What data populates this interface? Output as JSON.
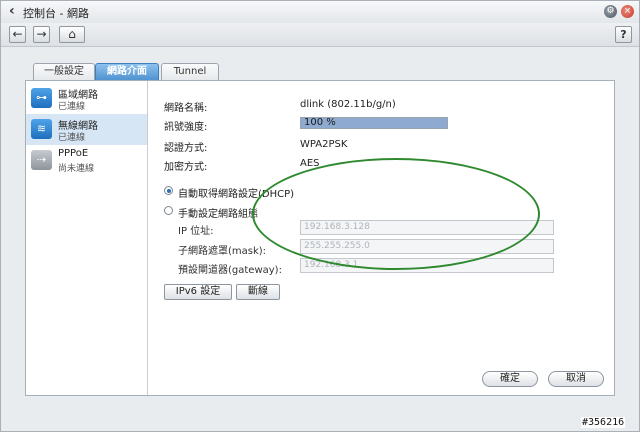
{
  "window": {
    "title": "控制台 - 網路"
  },
  "tabs": [
    {
      "label": "一般設定"
    },
    {
      "label": "網路介面"
    },
    {
      "label": "Tunnel"
    }
  ],
  "sidebar": {
    "items": [
      {
        "name": "區域網路",
        "status": "已連線"
      },
      {
        "name": "無線網路",
        "status": "已連線"
      },
      {
        "name": "PPPoE",
        "status": "尚未連線"
      }
    ]
  },
  "wireless": {
    "ssid_label": "網路名稱:",
    "ssid_value": "dlink (802.11b/g/n)",
    "signal_label": "訊號強度:",
    "signal_text": "100 %",
    "signal_percent": 100,
    "auth_label": "認證方式:",
    "auth_value": "WPA2PSK",
    "enc_label": "加密方式:",
    "enc_value": "AES"
  },
  "ip_settings": {
    "dhcp_label": "自動取得網路設定(DHCP)",
    "manual_label": "手動設定網路組態",
    "ip_label": "IP 位址:",
    "ip_value": "192.168.3.128",
    "mask_label": "子網路遮罩(mask):",
    "mask_value": "255.255.255.0",
    "gw_label": "預設閘道器(gateway):",
    "gw_value": "192.168.3.1"
  },
  "buttons": {
    "ipv6": "IPv6 設定",
    "disconnect": "斷線",
    "ok": "確定",
    "cancel": "取消",
    "help": "?"
  },
  "watermark": "#356216",
  "colors": {
    "annotation_oval": "#2f8a2f",
    "active_tab": "#4f93d0",
    "signal_fill": "#8eaad0"
  },
  "icons": {
    "back": "back-arrow-icon",
    "forward": "forward-arrow-icon",
    "home": "home-icon",
    "gear": "gear-icon",
    "close": "close-icon"
  }
}
